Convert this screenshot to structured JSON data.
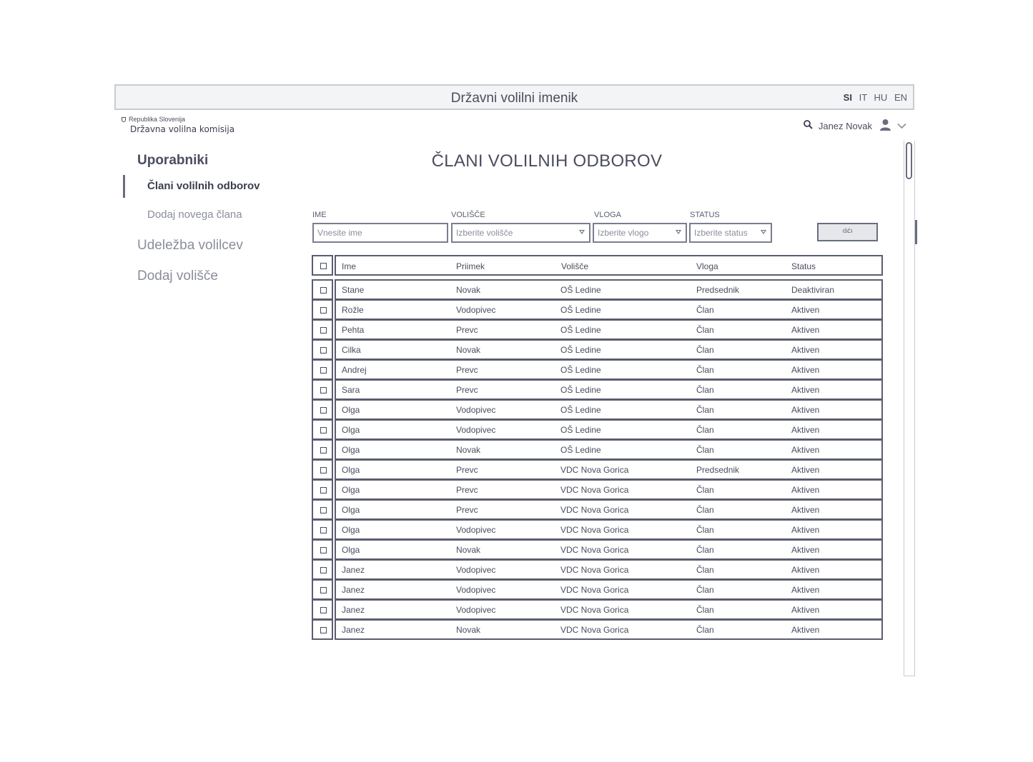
{
  "header": {
    "title": "Državni volilni imenik",
    "languages": [
      "SI",
      "IT",
      "HU",
      "EN"
    ],
    "active_language": "SI"
  },
  "logo": {
    "top": "Republika Slovenija",
    "main": "Državna volilna komisija"
  },
  "user": {
    "name": "Janez Novak",
    "icons": [
      "search-icon",
      "user-icon",
      "chevron-down-icon"
    ]
  },
  "sidebar": {
    "section_users": "Uporabniki",
    "active_item": "Člani volilnih odborov",
    "sub_item": "Dodaj novega člana",
    "section_turnout": "Udeležba volilcev",
    "section_add_station": "Dodaj volišče"
  },
  "page": {
    "title": "ČLANI VOLILNIH ODBOROV"
  },
  "filters": {
    "name_label": "IME",
    "name_placeholder": "Vnesite ime",
    "station_label": "VOLIŠČE",
    "station_value": "Izberite volišče",
    "role_label": "VLOGA",
    "role_value": "Izberite vlogo",
    "status_label": "STATUS",
    "status_value": "Izberite status",
    "search_button": "IŠČI"
  },
  "table": {
    "headers": [
      "Ime",
      "Priimek",
      "Volišče",
      "Vloga",
      "Status"
    ],
    "rows": [
      [
        "Stane",
        "Novak",
        "OŠ Ledine",
        "Predsednik",
        "Deaktiviran"
      ],
      [
        "Rožle",
        "Vodopivec",
        "OŠ Ledine",
        "Član",
        "Aktiven"
      ],
      [
        "Pehta",
        "Prevc",
        "OŠ Ledine",
        "Član",
        "Aktiven"
      ],
      [
        "Cilka",
        "Novak",
        "OŠ Ledine",
        "Član",
        "Aktiven"
      ],
      [
        "Andrej",
        "Prevc",
        "OŠ Ledine",
        "Član",
        "Aktiven"
      ],
      [
        "Sara",
        "Prevc",
        "OŠ Ledine",
        "Član",
        "Aktiven"
      ],
      [
        "Olga",
        "Vodopivec",
        "OŠ Ledine",
        "Član",
        "Aktiven"
      ],
      [
        "Olga",
        "Vodopivec",
        "OŠ Ledine",
        "Član",
        "Aktiven"
      ],
      [
        "Olga",
        "Novak",
        "OŠ Ledine",
        "Član",
        "Aktiven"
      ],
      [
        "Olga",
        "Prevc",
        "VDC Nova Gorica",
        "Predsednik",
        "Aktiven"
      ],
      [
        "Olga",
        "Prevc",
        "VDC Nova Gorica",
        "Član",
        "Aktiven"
      ],
      [
        "Olga",
        "Prevc",
        "VDC Nova Gorica",
        "Član",
        "Aktiven"
      ],
      [
        "Olga",
        "Vodopivec",
        "VDC Nova Gorica",
        "Član",
        "Aktiven"
      ],
      [
        "Olga",
        "Novak",
        "VDC Nova Gorica",
        "Član",
        "Aktiven"
      ],
      [
        "Janez",
        "Vodopivec",
        "VDC Nova Gorica",
        "Član",
        "Aktiven"
      ],
      [
        "Janez",
        "Vodopivec",
        "VDC Nova Gorica",
        "Član",
        "Aktiven"
      ],
      [
        "Janez",
        "Vodopivec",
        "VDC Nova Gorica",
        "Član",
        "Aktiven"
      ],
      [
        "Janez",
        "Novak",
        "VDC Nova Gorica",
        "Član",
        "Aktiven"
      ]
    ]
  }
}
